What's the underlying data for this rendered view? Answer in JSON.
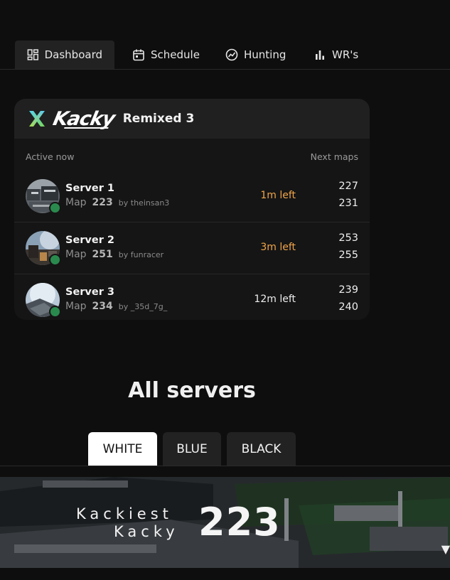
{
  "nav": {
    "tabs": [
      {
        "label": "Dashboard",
        "icon": "dashboard-icon",
        "active": true
      },
      {
        "label": "Schedule",
        "icon": "calendar-icon",
        "active": false
      },
      {
        "label": "Hunting",
        "icon": "trend-icon",
        "active": false
      },
      {
        "label": "WR's",
        "icon": "bar-chart-icon",
        "active": false
      }
    ]
  },
  "event": {
    "logo_text": "Kacky",
    "subtitle": "Remixed 3",
    "active_label": "Active now",
    "next_label": "Next maps",
    "servers": [
      {
        "name": "Server 1",
        "map_word": "Map",
        "map_number": "223",
        "author": "by theinsan3",
        "time_left": "1m left",
        "time_color": "#f0a54a",
        "next": [
          "227",
          "231"
        ]
      },
      {
        "name": "Server 2",
        "map_word": "Map",
        "map_number": "251",
        "author": "by funracer",
        "time_left": "3m left",
        "time_color": "#f0a54a",
        "next": [
          "253",
          "255"
        ]
      },
      {
        "name": "Server 3",
        "map_word": "Map",
        "map_number": "234",
        "author": "by _35d_7g_",
        "time_left": "12m left",
        "time_color": "#ededed",
        "next": [
          "239",
          "240"
        ]
      }
    ]
  },
  "all_servers": {
    "title": "All servers",
    "buttons": [
      {
        "label": "WHITE",
        "active": true
      },
      {
        "label": "BLUE",
        "active": false
      },
      {
        "label": "BLACK",
        "active": false
      }
    ]
  },
  "banner": {
    "line1": "Kackiest",
    "line2": "Kacky",
    "number": "223"
  },
  "colors": {
    "background": "#0e0e0e",
    "card": "#151515",
    "online": "#2a8a4e",
    "warning": "#f0a54a"
  }
}
